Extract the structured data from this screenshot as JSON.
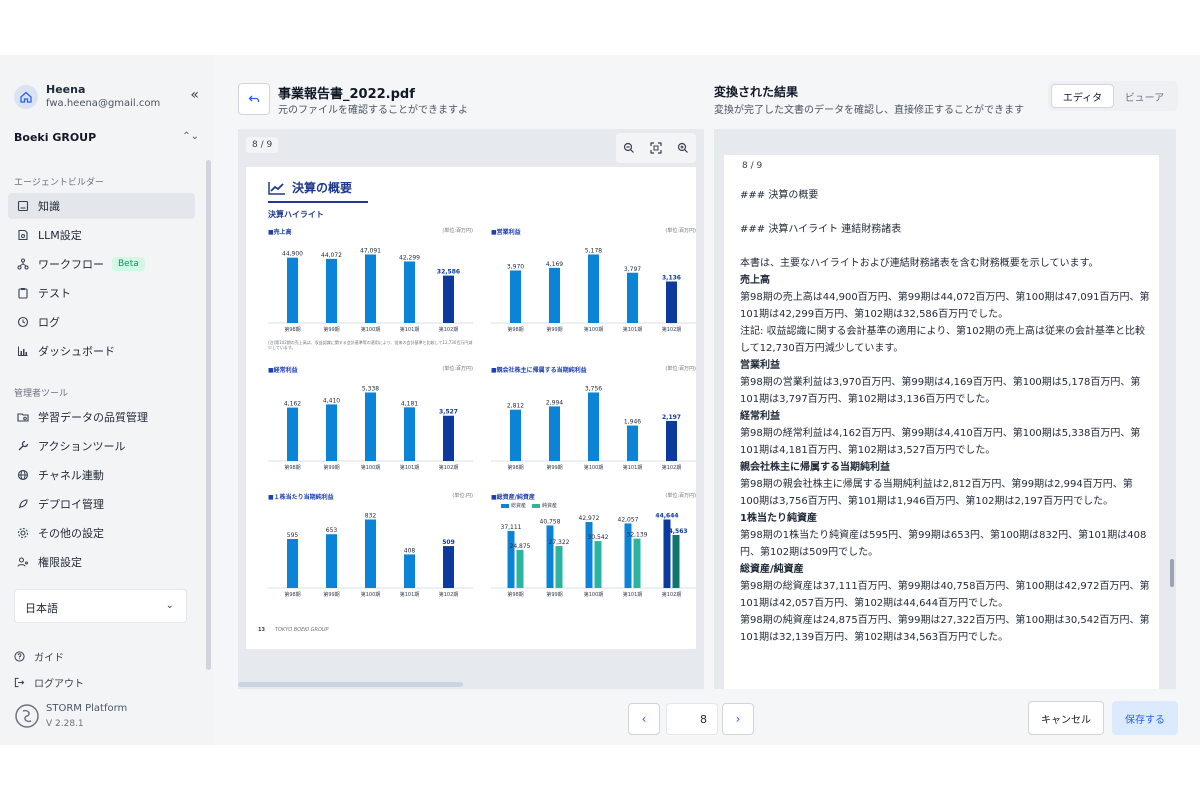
{
  "sidebar": {
    "user_name": "Heena",
    "user_email": "fwa.heena@gmail.com",
    "org": "Boeki GROUP",
    "section_agent": "エージェントビルダー",
    "items": [
      {
        "label": "知識",
        "icon": "book-icon"
      },
      {
        "label": "LLM設定",
        "icon": "llm-icon"
      },
      {
        "label": "ワークフロー",
        "icon": "workflow-icon",
        "badge": "Beta"
      },
      {
        "label": "テスト",
        "icon": "clipboard-icon"
      },
      {
        "label": "ログ",
        "icon": "history-icon"
      },
      {
        "label": "ダッシュボード",
        "icon": "chart-icon"
      }
    ],
    "section_admin": "管理者ツール",
    "admin_items": [
      {
        "label": "学習データの品質管理",
        "icon": "folder-search-icon"
      },
      {
        "label": "アクションツール",
        "icon": "wrench-icon"
      },
      {
        "label": "チャネル連動",
        "icon": "globe-icon"
      },
      {
        "label": "デプロイ管理",
        "icon": "rocket-icon"
      },
      {
        "label": "その他の設定",
        "icon": "gear-icon"
      },
      {
        "label": "権限設定",
        "icon": "user-key-icon"
      }
    ],
    "language": "日本語",
    "guide": "ガイド",
    "logout": "ログアウト",
    "platform_name": "STORM Platform",
    "platform_version": "V 2.28.1"
  },
  "left_panel": {
    "title": "事業報告書_2022.pdf",
    "subtitle": "元のファイルを確認することができますよ",
    "page_indicator": "8 / 9"
  },
  "pdf": {
    "heading": "決算の概要",
    "subheading": "決算ハイライト",
    "footer_page": "13",
    "footer_org": "TOKYO BOEKI GROUP",
    "note": "(注)第102期の売上高は、収益認識に関する会計基準等の適用により、従来の会計基準と比較して12,730百万円減少しています。",
    "legend": [
      "総資産",
      "純資産"
    ]
  },
  "chart_data": [
    {
      "type": "bar",
      "title": "■売上高",
      "unit": "(単位:百万円)",
      "categories": [
        "第98期",
        "第99期",
        "第100期",
        "第101期",
        "第102期"
      ],
      "values": [
        44900,
        44072,
        47091,
        42299,
        32586
      ],
      "labels": [
        "44,900",
        "44,072",
        "47,091",
        "42,299",
        "32,586"
      ]
    },
    {
      "type": "bar",
      "title": "■営業利益",
      "unit": "(単位:百万円)",
      "categories": [
        "第98期",
        "第99期",
        "第100期",
        "第101期",
        "第102期"
      ],
      "values": [
        3970,
        4169,
        5178,
        3797,
        3136
      ],
      "labels": [
        "3,970",
        "4,169",
        "5,178",
        "3,797",
        "3,136"
      ]
    },
    {
      "type": "bar",
      "title": "■経常利益",
      "unit": "(単位:百万円)",
      "categories": [
        "第98期",
        "第99期",
        "第100期",
        "第101期",
        "第102期"
      ],
      "values": [
        4162,
        4410,
        5338,
        4181,
        3527
      ],
      "labels": [
        "4,162",
        "4,410",
        "5,338",
        "4,181",
        "3,527"
      ]
    },
    {
      "type": "bar",
      "title": "■親会社株主に帰属する当期純利益",
      "unit": "(単位:百万円)",
      "categories": [
        "第98期",
        "第99期",
        "第100期",
        "第101期",
        "第102期"
      ],
      "values": [
        2812,
        2994,
        3756,
        1946,
        2197
      ],
      "labels": [
        "2,812",
        "2,994",
        "3,756",
        "1,946",
        "2,197"
      ]
    },
    {
      "type": "bar",
      "title": "■１株当たり当期純利益",
      "unit": "(単位:円)",
      "categories": [
        "第98期",
        "第99期",
        "第100期",
        "第101期",
        "第102期"
      ],
      "values": [
        595,
        653,
        832,
        408,
        509
      ],
      "labels": [
        "595",
        "653",
        "832",
        "408",
        "509"
      ]
    },
    {
      "type": "bar",
      "title": "■総資産/純資産",
      "unit": "(単位:百万円)",
      "categories": [
        "第98期",
        "第99期",
        "第100期",
        "第101期",
        "第102期"
      ],
      "series": [
        {
          "name": "総資産",
          "values": [
            37111,
            40758,
            42972,
            42057,
            44644
          ],
          "labels": [
            "37,111",
            "40,758",
            "42,972",
            "42,057",
            "44,644"
          ]
        },
        {
          "name": "純資産",
          "values": [
            24875,
            27322,
            30542,
            32139,
            34563
          ],
          "labels": [
            "24,875",
            "27,322",
            "30,542",
            "32,139",
            "34,563"
          ]
        }
      ]
    }
  ],
  "right_panel": {
    "title": "変換された結果",
    "subtitle": "変換が完了した文書のデータを確認し、直接修正することができます",
    "toggle_editor": "エディタ",
    "toggle_viewer": "ビューア",
    "page_indicator": "8 / 9",
    "lines": [
      {
        "t": "### 決算の概要",
        "h": false
      },
      {
        "t": "",
        "h": false
      },
      {
        "t": "### 決算ハイライト 連結財務諸表",
        "h": false
      },
      {
        "t": "",
        "h": false
      },
      {
        "t": "本書は、主要なハイライトおよび連結財務諸表を含む財務概要を示しています。",
        "h": false
      },
      {
        "t": "売上高",
        "h": true
      },
      {
        "t": "第98期の売上高は44,900百万円、第99期は44,072百万円、第100期は47,091百万円、第101期は42,299百万円、第102期は32,586百万円でした。",
        "h": false
      },
      {
        "t": "注記: 収益認識に関する会計基準の適用により、第102期の売上高は従来の会計基準と比較して12,730百万円減少しています。",
        "h": false
      },
      {
        "t": "営業利益",
        "h": true
      },
      {
        "t": "第98期の営業利益は3,970百万円、第99期は4,169百万円、第100期は5,178百万円、第101期は3,797百万円、第102期は3,136百万円でした。",
        "h": false
      },
      {
        "t": "経常利益",
        "h": true
      },
      {
        "t": "第98期の経常利益は4,162百万円、第99期は4,410百万円、第100期は5,338百万円、第101期は4,181百万円、第102期は3,527百万円でした。",
        "h": false
      },
      {
        "t": "親会社株主に帰属する当期純利益",
        "h": true
      },
      {
        "t": "第98期の親会社株主に帰属する当期純利益は2,812百万円、第99期は2,994百万円、第100期は3,756百万円、第101期は1,946百万円、第102期は2,197百万円でした。",
        "h": false
      },
      {
        "t": "1株当たり純資産",
        "h": true
      },
      {
        "t": "第98期の1株当たり純資産は595円、第99期は653円、第100期は832円、第101期は408円、第102期は509円でした。",
        "h": false
      },
      {
        "t": "総資産/純資産",
        "h": true
      },
      {
        "t": "第98期の総資産は37,111百万円、第99期は40,758百万円、第100期は42,972百万円、第101期は42,057百万円、第102期は44,644百万円でした。",
        "h": false
      },
      {
        "t": "第98期の純資産は24,875百万円、第99期は27,322百万円、第100期は30,542百万円、第101期は32,139百万円、第102期は34,563百万円でした。",
        "h": false
      }
    ]
  },
  "pagination": {
    "current": "8",
    "prev": "‹",
    "next": "›"
  },
  "actions": {
    "cancel": "キャンセル",
    "save": "保存する"
  },
  "colors": {
    "bar": "#0b84d8",
    "bar_latest": "#0d3a9e",
    "accent": "#2563eb",
    "teal": "#2bb5a0",
    "teal_latest": "#0f766e"
  }
}
